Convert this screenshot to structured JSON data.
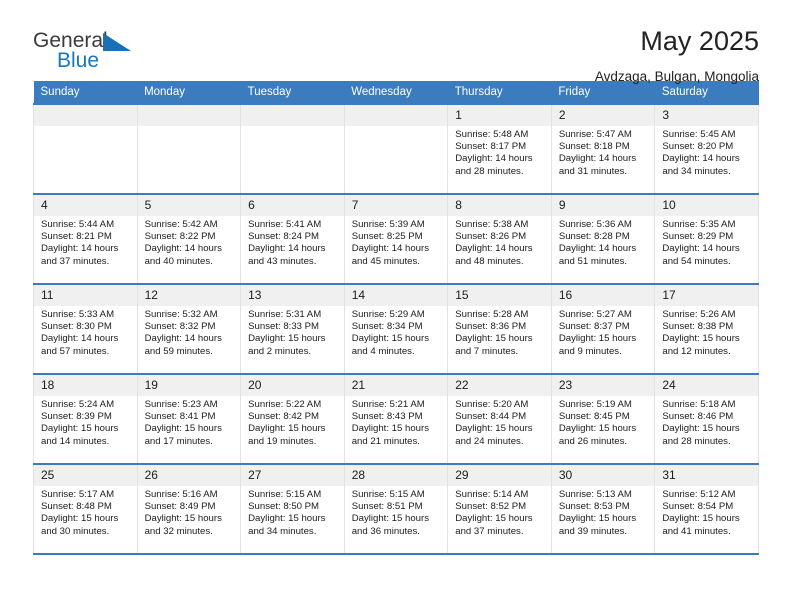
{
  "brand": {
    "name_part1": "General",
    "name_part2": "Blue",
    "triangle_color": "#1b6fb5",
    "blue_color": "#1577c4"
  },
  "header": {
    "title": "May 2025",
    "subtitle": "Avdzaga, Bulgan, Mongolia",
    "accent_color": "#3a7cbe"
  },
  "calendar": {
    "weekday_headers": [
      "Sunday",
      "Monday",
      "Tuesday",
      "Wednesday",
      "Thursday",
      "Friday",
      "Saturday"
    ],
    "weeks": [
      [
        {
          "day": "",
          "lines": []
        },
        {
          "day": "",
          "lines": []
        },
        {
          "day": "",
          "lines": []
        },
        {
          "day": "",
          "lines": []
        },
        {
          "day": "1",
          "lines": [
            "Sunrise: 5:48 AM",
            "Sunset: 8:17 PM",
            "Daylight: 14 hours",
            "and 28 minutes."
          ]
        },
        {
          "day": "2",
          "lines": [
            "Sunrise: 5:47 AM",
            "Sunset: 8:18 PM",
            "Daylight: 14 hours",
            "and 31 minutes."
          ]
        },
        {
          "day": "3",
          "lines": [
            "Sunrise: 5:45 AM",
            "Sunset: 8:20 PM",
            "Daylight: 14 hours",
            "and 34 minutes."
          ]
        }
      ],
      [
        {
          "day": "4",
          "lines": [
            "Sunrise: 5:44 AM",
            "Sunset: 8:21 PM",
            "Daylight: 14 hours",
            "and 37 minutes."
          ]
        },
        {
          "day": "5",
          "lines": [
            "Sunrise: 5:42 AM",
            "Sunset: 8:22 PM",
            "Daylight: 14 hours",
            "and 40 minutes."
          ]
        },
        {
          "day": "6",
          "lines": [
            "Sunrise: 5:41 AM",
            "Sunset: 8:24 PM",
            "Daylight: 14 hours",
            "and 43 minutes."
          ]
        },
        {
          "day": "7",
          "lines": [
            "Sunrise: 5:39 AM",
            "Sunset: 8:25 PM",
            "Daylight: 14 hours",
            "and 45 minutes."
          ]
        },
        {
          "day": "8",
          "lines": [
            "Sunrise: 5:38 AM",
            "Sunset: 8:26 PM",
            "Daylight: 14 hours",
            "and 48 minutes."
          ]
        },
        {
          "day": "9",
          "lines": [
            "Sunrise: 5:36 AM",
            "Sunset: 8:28 PM",
            "Daylight: 14 hours",
            "and 51 minutes."
          ]
        },
        {
          "day": "10",
          "lines": [
            "Sunrise: 5:35 AM",
            "Sunset: 8:29 PM",
            "Daylight: 14 hours",
            "and 54 minutes."
          ]
        }
      ],
      [
        {
          "day": "11",
          "lines": [
            "Sunrise: 5:33 AM",
            "Sunset: 8:30 PM",
            "Daylight: 14 hours",
            "and 57 minutes."
          ]
        },
        {
          "day": "12",
          "lines": [
            "Sunrise: 5:32 AM",
            "Sunset: 8:32 PM",
            "Daylight: 14 hours",
            "and 59 minutes."
          ]
        },
        {
          "day": "13",
          "lines": [
            "Sunrise: 5:31 AM",
            "Sunset: 8:33 PM",
            "Daylight: 15 hours",
            "and 2 minutes."
          ]
        },
        {
          "day": "14",
          "lines": [
            "Sunrise: 5:29 AM",
            "Sunset: 8:34 PM",
            "Daylight: 15 hours",
            "and 4 minutes."
          ]
        },
        {
          "day": "15",
          "lines": [
            "Sunrise: 5:28 AM",
            "Sunset: 8:36 PM",
            "Daylight: 15 hours",
            "and 7 minutes."
          ]
        },
        {
          "day": "16",
          "lines": [
            "Sunrise: 5:27 AM",
            "Sunset: 8:37 PM",
            "Daylight: 15 hours",
            "and 9 minutes."
          ]
        },
        {
          "day": "17",
          "lines": [
            "Sunrise: 5:26 AM",
            "Sunset: 8:38 PM",
            "Daylight: 15 hours",
            "and 12 minutes."
          ]
        }
      ],
      [
        {
          "day": "18",
          "lines": [
            "Sunrise: 5:24 AM",
            "Sunset: 8:39 PM",
            "Daylight: 15 hours",
            "and 14 minutes."
          ]
        },
        {
          "day": "19",
          "lines": [
            "Sunrise: 5:23 AM",
            "Sunset: 8:41 PM",
            "Daylight: 15 hours",
            "and 17 minutes."
          ]
        },
        {
          "day": "20",
          "lines": [
            "Sunrise: 5:22 AM",
            "Sunset: 8:42 PM",
            "Daylight: 15 hours",
            "and 19 minutes."
          ]
        },
        {
          "day": "21",
          "lines": [
            "Sunrise: 5:21 AM",
            "Sunset: 8:43 PM",
            "Daylight: 15 hours",
            "and 21 minutes."
          ]
        },
        {
          "day": "22",
          "lines": [
            "Sunrise: 5:20 AM",
            "Sunset: 8:44 PM",
            "Daylight: 15 hours",
            "and 24 minutes."
          ]
        },
        {
          "day": "23",
          "lines": [
            "Sunrise: 5:19 AM",
            "Sunset: 8:45 PM",
            "Daylight: 15 hours",
            "and 26 minutes."
          ]
        },
        {
          "day": "24",
          "lines": [
            "Sunrise: 5:18 AM",
            "Sunset: 8:46 PM",
            "Daylight: 15 hours",
            "and 28 minutes."
          ]
        }
      ],
      [
        {
          "day": "25",
          "lines": [
            "Sunrise: 5:17 AM",
            "Sunset: 8:48 PM",
            "Daylight: 15 hours",
            "and 30 minutes."
          ]
        },
        {
          "day": "26",
          "lines": [
            "Sunrise: 5:16 AM",
            "Sunset: 8:49 PM",
            "Daylight: 15 hours",
            "and 32 minutes."
          ]
        },
        {
          "day": "27",
          "lines": [
            "Sunrise: 5:15 AM",
            "Sunset: 8:50 PM",
            "Daylight: 15 hours",
            "and 34 minutes."
          ]
        },
        {
          "day": "28",
          "lines": [
            "Sunrise: 5:15 AM",
            "Sunset: 8:51 PM",
            "Daylight: 15 hours",
            "and 36 minutes."
          ]
        },
        {
          "day": "29",
          "lines": [
            "Sunrise: 5:14 AM",
            "Sunset: 8:52 PM",
            "Daylight: 15 hours",
            "and 37 minutes."
          ]
        },
        {
          "day": "30",
          "lines": [
            "Sunrise: 5:13 AM",
            "Sunset: 8:53 PM",
            "Daylight: 15 hours",
            "and 39 minutes."
          ]
        },
        {
          "day": "31",
          "lines": [
            "Sunrise: 5:12 AM",
            "Sunset: 8:54 PM",
            "Daylight: 15 hours",
            "and 41 minutes."
          ]
        }
      ]
    ]
  }
}
